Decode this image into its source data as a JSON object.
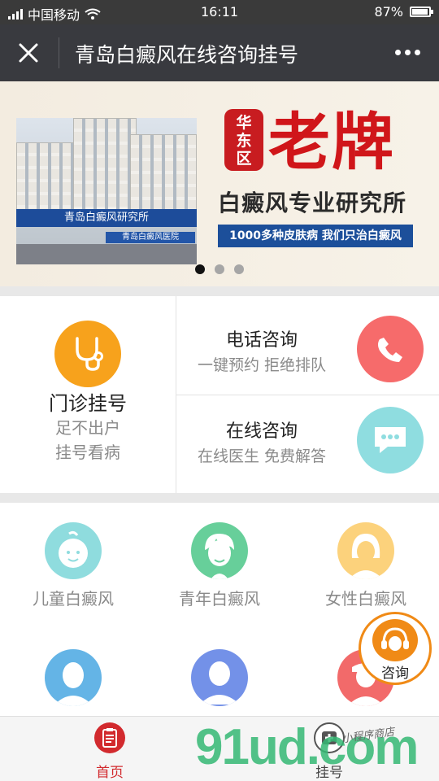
{
  "status_bar": {
    "carrier": "中国移动",
    "time": "16:11",
    "battery": "87%",
    "battery_level": 0.87
  },
  "title_bar": {
    "title": "青岛白癜风在线咨询挂号"
  },
  "banner": {
    "seal_text": "华东区",
    "headline": "老牌",
    "subtitle": "白癜风专业研究所",
    "strip": "1000多种皮肤病 我们只治白癜风",
    "building_sign": "青岛白癜风研究所",
    "building_sign_2": "青岛白癜风医院",
    "slide_count": 3,
    "active_slide": 1
  },
  "services": {
    "registration": {
      "title": "门诊挂号",
      "line1": "足不出户",
      "line2": "挂号看病",
      "icon": "stethoscope-icon"
    },
    "phone": {
      "title": "电话咨询",
      "sub": "一键预约 拒绝排队",
      "icon": "phone-icon"
    },
    "online": {
      "title": "在线咨询",
      "sub": "在线医生 免费解答",
      "icon": "chat-icon"
    }
  },
  "categories": [
    {
      "label": "儿童白癜风",
      "color": "#8fdcde",
      "icon": "child-icon"
    },
    {
      "label": "青年白癜风",
      "color": "#67cf9a",
      "icon": "youth-icon"
    },
    {
      "label": "女性白癜风",
      "color": "#fcd27c",
      "icon": "woman-icon"
    },
    {
      "label": "",
      "color": "#64b4e6",
      "icon": "man-icon"
    },
    {
      "label": "",
      "color": "#7391e8",
      "icon": "adult-icon"
    },
    {
      "label": "",
      "color": "#f26a6a",
      "icon": "elder-icon"
    }
  ],
  "floating_consult": {
    "label": "咨询"
  },
  "tab_bar": {
    "home": "首页",
    "register": "挂号",
    "active_color": "#d22a2e"
  },
  "watermark": {
    "text": "91ud.com",
    "tagline": "小程序商店"
  }
}
